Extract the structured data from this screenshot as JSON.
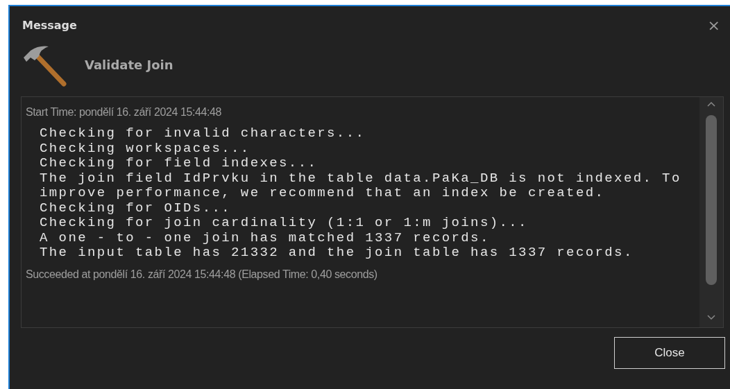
{
  "window": {
    "title": "Message",
    "close_glyph": "×"
  },
  "tool": {
    "name": "Validate Join"
  },
  "log": {
    "start": "Start Time: pondělí 16. září 2024 15:44:48",
    "lines": [
      "Checking for invalid characters...",
      "Checking workspaces...",
      "Checking for field indexes...",
      "The join field IdPrvku in the table data.PaKa_DB is not indexed. To",
      "improve performance, we recommend that an index be created.",
      "Checking for OIDs...",
      "Checking for join cardinality (1:1 or 1:m joins)...",
      "A one - to - one join has matched 1337 records.",
      "The input table has 21332 and the join table has 1337 records."
    ],
    "end": "Succeeded at pondělí 16. září 2024 15:44:48 (Elapsed Time: 0,40 seconds)"
  },
  "buttons": [
    "Close"
  ]
}
